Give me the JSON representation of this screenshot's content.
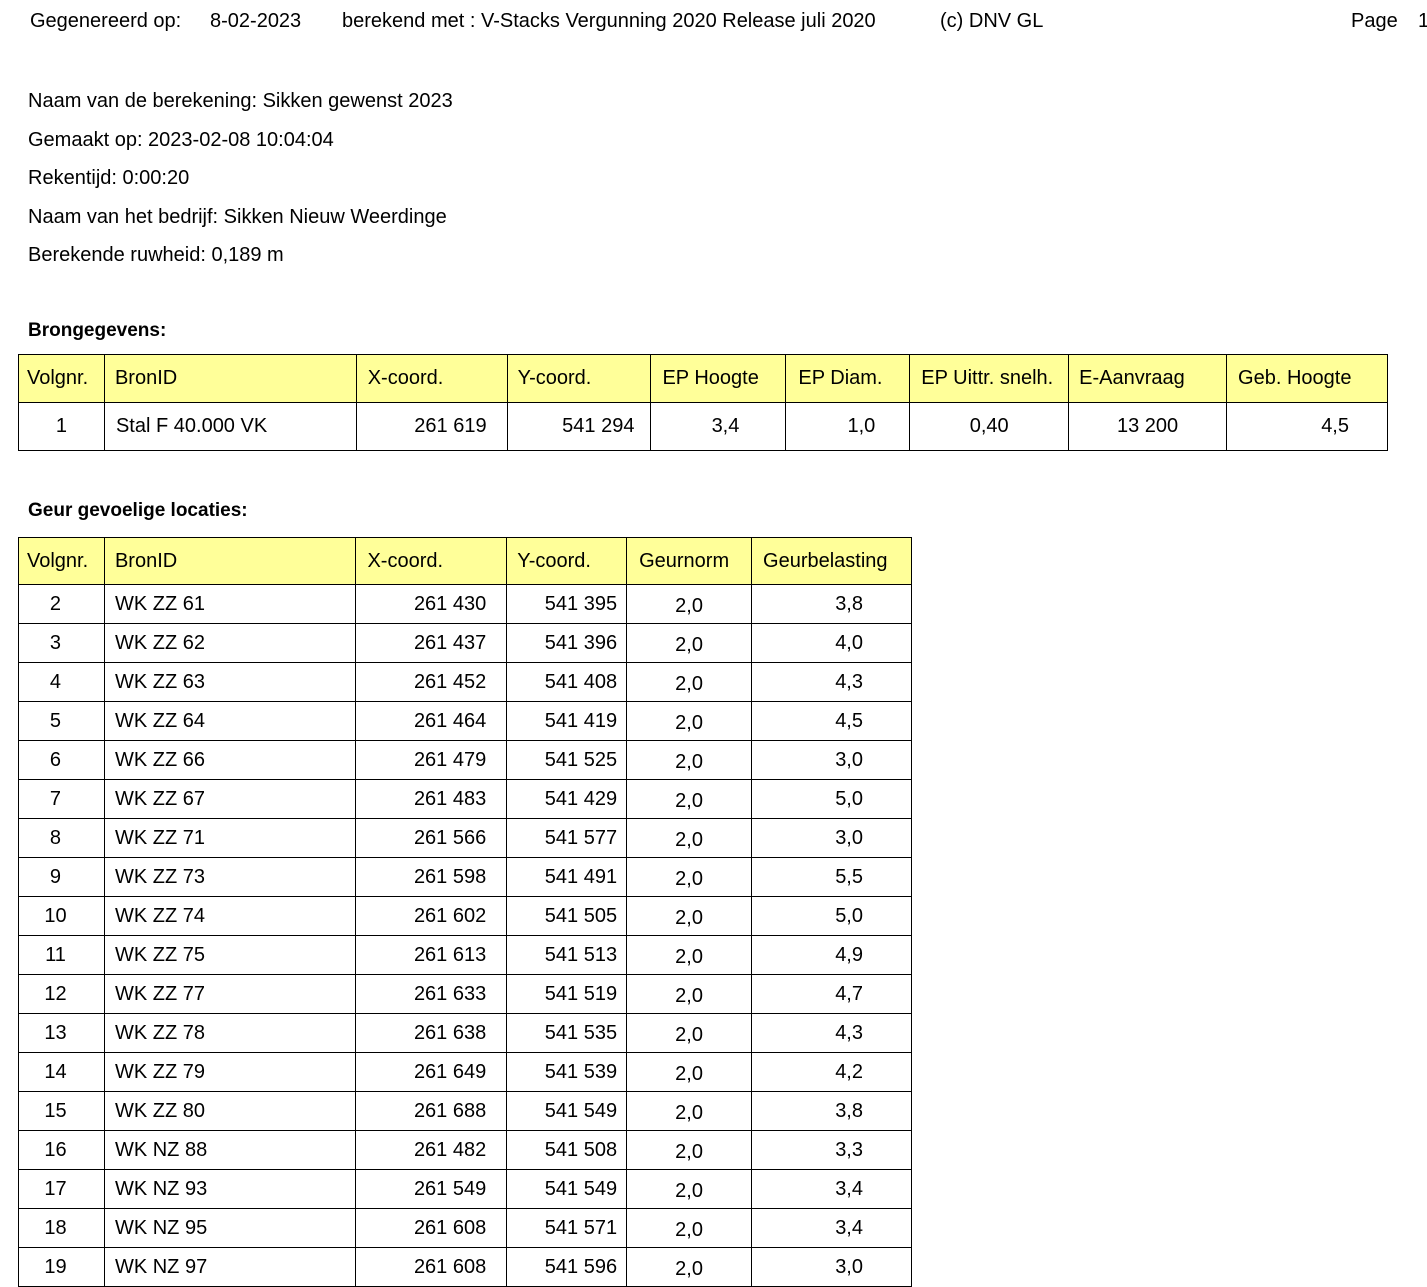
{
  "header": {
    "generated_label": "Gegenereerd op:",
    "generated_date": "8-02-2023",
    "computed_with": "berekend met : V-Stacks Vergunning 2020  Release juli 2020",
    "copyright": "(c) DNV GL",
    "page_label": "Page",
    "page_number": "1"
  },
  "meta": {
    "calc_name": "Naam van de berekening:  Sikken gewenst 2023",
    "made_on": "Gemaakt op:  2023-02-08   10:04:04",
    "calc_time": "Rekentijd:  0:00:20",
    "company": "Naam van het bedrijf:  Sikken Nieuw Weerdinge",
    "roughness": "Berekende ruwheid: 0,189 m"
  },
  "sources": {
    "title": "Brongegevens:",
    "columns": [
      "Volgnr.",
      "BronID",
      "X-coord.",
      "Y-coord.",
      "EP Hoogte",
      "EP Diam.",
      "EP Uittr. snelh.",
      "E-Aanvraag",
      "Geb. Hoogte"
    ],
    "rows": [
      [
        "1",
        "Stal F 40.000 VK",
        "261 619",
        "541 294",
        "3,4",
        "1,0",
        "0,40",
        "13 200",
        "4,5"
      ]
    ]
  },
  "receptors": {
    "title": "Geur gevoelige locaties:",
    "columns": [
      "Volgnr.",
      "BronID",
      "X-coord.",
      "Y-coord.",
      "Geurnorm",
      "Geurbelasting"
    ],
    "rows": [
      [
        "2",
        "WK ZZ 61",
        "261 430",
        "541 395",
        "2,0",
        "3,8"
      ],
      [
        "3",
        "WK ZZ 62",
        "261 437",
        "541 396",
        "2,0",
        "4,0"
      ],
      [
        "4",
        "WK ZZ 63",
        "261 452",
        "541 408",
        "2,0",
        "4,3"
      ],
      [
        "5",
        "WK ZZ 64",
        "261 464",
        "541 419",
        "2,0",
        "4,5"
      ],
      [
        "6",
        "WK ZZ 66",
        "261 479",
        "541 525",
        "2,0",
        "3,0"
      ],
      [
        "7",
        "WK ZZ 67",
        "261 483",
        "541 429",
        "2,0",
        "5,0"
      ],
      [
        "8",
        "WK ZZ 71",
        "261 566",
        "541 577",
        "2,0",
        "3,0"
      ],
      [
        "9",
        "WK ZZ 73",
        "261 598",
        "541 491",
        "2,0",
        "5,5"
      ],
      [
        "10",
        "WK ZZ 74",
        "261 602",
        "541 505",
        "2,0",
        "5,0"
      ],
      [
        "11",
        "WK ZZ 75",
        "261 613",
        "541 513",
        "2,0",
        "4,9"
      ],
      [
        "12",
        "WK ZZ 77",
        "261 633",
        "541 519",
        "2,0",
        "4,7"
      ],
      [
        "13",
        "WK ZZ 78",
        "261 638",
        "541 535",
        "2,0",
        "4,3"
      ],
      [
        "14",
        "WK ZZ 79",
        "261 649",
        "541 539",
        "2,0",
        "4,2"
      ],
      [
        "15",
        "WK ZZ 80",
        "261 688",
        "541 549",
        "2,0",
        "3,8"
      ],
      [
        "16",
        "WK NZ 88",
        "261 482",
        "541 508",
        "2,0",
        "3,3"
      ],
      [
        "17",
        "WK NZ 93",
        "261 549",
        "541 549",
        "2,0",
        "3,4"
      ],
      [
        "18",
        "WK NZ 95",
        "261 608",
        "541 571",
        "2,0",
        "3,4"
      ],
      [
        "19",
        "WK NZ 97",
        "261 608",
        "541 596",
        "2,0",
        "3,0"
      ]
    ]
  }
}
